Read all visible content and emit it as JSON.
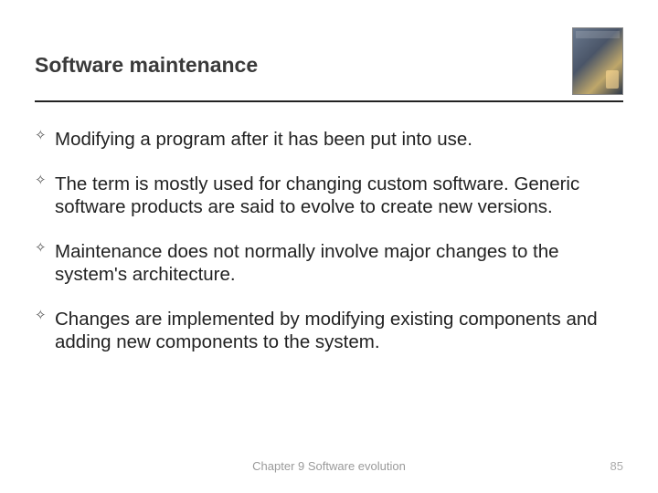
{
  "title": "Software maintenance",
  "bullets": [
    "Modifying a program after it has been put into use.",
    "The term is mostly used for changing custom software. Generic software products are said to evolve to create new versions.",
    "Maintenance does not normally involve major changes to the system's architecture.",
    "Changes are implemented by modifying existing components and adding new components to the system."
  ],
  "footer": "Chapter 9 Software evolution",
  "page_number": "85"
}
